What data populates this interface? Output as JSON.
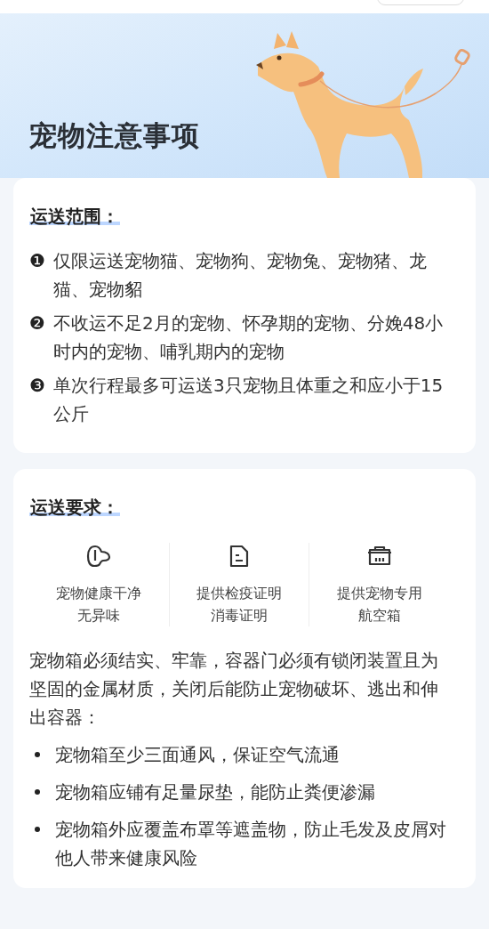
{
  "header": {
    "title": "宠物注意事项"
  },
  "scope": {
    "title": "运送范围：",
    "items": [
      {
        "number": "❶",
        "text": "仅限运送宠物猫、宠物狗、宠物兔、宠物猪、龙猫、宠物貂"
      },
      {
        "number": "❷",
        "text": "不收运不足2月的宠物、怀孕期的宠物、分娩48小时内的宠物、哺乳期内的宠物"
      },
      {
        "number": "❸",
        "text": "单次行程最多可运送3只宠物且体重之和应小于15公斤"
      }
    ]
  },
  "requirements": {
    "title": "运送要求：",
    "features": [
      {
        "kind": "dog",
        "text": "宠物健康干净无异味"
      },
      {
        "kind": "document",
        "text": "提供检疫证明消毒证明"
      },
      {
        "kind": "carrier",
        "text": "提供宠物专用航空箱"
      }
    ],
    "description": "宠物箱必须结实、牢靠，容器门必须有锁闭装置且为坚固的金属材质，关闭后能防止宠物破坏、逃出和伸出容器：",
    "bullets": [
      "宠物箱至少三面通风，保证空气流通",
      "宠物箱应铺有足量尿垫，能防止粪便渗漏",
      "宠物箱外应覆盖布罩等遮盖物，防止毛发及皮屑对他人带来健康风险"
    ]
  }
}
